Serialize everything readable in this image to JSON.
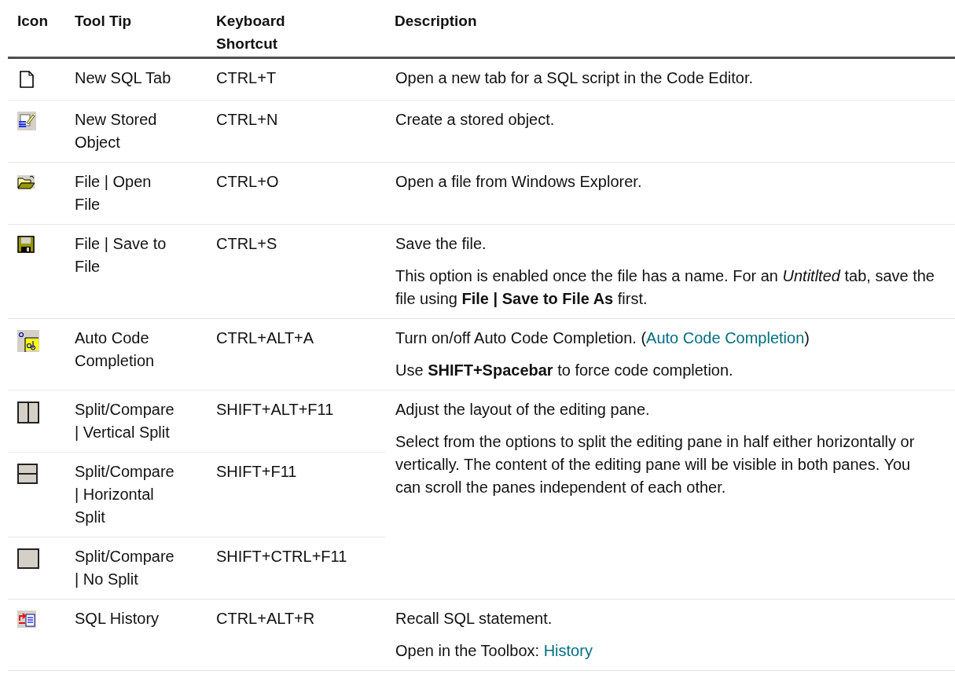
{
  "table": {
    "columns": [
      "Icon",
      "Tool Tip",
      "Keyboard Shortcut",
      "Description"
    ],
    "rows": [
      {
        "kind": "page",
        "tooltip": "New SQL Tab",
        "shortcut": "CTRL+T",
        "description": [
          [
            {
              "kind": "text",
              "text": "Open a new tab for a SQL script in the Code Editor."
            }
          ]
        ]
      },
      {
        "kind": "stored-object",
        "tooltip": "New Stored Object",
        "shortcut": "CTRL+N",
        "description": [
          [
            {
              "kind": "text",
              "text": "Create a stored object."
            }
          ]
        ]
      },
      {
        "kind": "folder",
        "tooltip": "File | Open File",
        "shortcut": "CTRL+O",
        "description": [
          [
            {
              "kind": "text",
              "text": "Open a file from Windows Explorer."
            }
          ]
        ]
      },
      {
        "kind": "floppy",
        "tooltip": "File | Save to File",
        "shortcut": "CTRL+S",
        "description": [
          [
            {
              "kind": "text",
              "text": "Save the file."
            }
          ],
          [
            {
              "kind": "text",
              "text": "This option is enabled once the file has a name. For an *Untitlted* tab, save the file using **File | Save to File As** first."
            }
          ]
        ]
      },
      {
        "kind": "autocomplete",
        "tooltip": "Auto Code Completion",
        "shortcut": "CTRL+ALT+A",
        "description": [
          [
            {
              "kind": "text",
              "text": "Turn on/off Auto Code Completion. ("
            },
            {
              "kind": "link",
              "text": "Auto Code Completion"
            },
            {
              "kind": "text",
              "text": ")"
            }
          ],
          [
            {
              "kind": "text",
              "text": "Use **SHIFT+Spacebar** to force code completion."
            }
          ]
        ]
      },
      {
        "kind": "split-vertical",
        "tooltip": "Split/Compare | Vertical Split",
        "shortcut": "SHIFT+ALT+F11",
        "description": [
          [
            {
              "kind": "text",
              "text": "Adjust the layout of the editing pane."
            }
          ],
          [
            {
              "kind": "text",
              "text": "Select from the options to split the editing pane in half either horizontally or vertically. The content of the editing pane will be visible in both panes. You can scroll the panes independent of each other."
            }
          ]
        ]
      },
      {
        "kind": "split-horizontal",
        "tooltip": "Split/Compare | Horizontal Split",
        "shortcut": "SHIFT+F11"
      },
      {
        "kind": "no-split",
        "tooltip": "Split/Compare | No Split",
        "shortcut": "SHIFT+CTRL+F11"
      },
      {
        "kind": "history",
        "tooltip": "SQL History",
        "shortcut": "CTRL+ALT+R",
        "description": [
          [
            {
              "kind": "text",
              "text": "Recall SQL statement."
            }
          ],
          [
            {
              "kind": "text",
              "text": "Open in the Toolbox: "
            },
            {
              "kind": "link",
              "text": "History"
            }
          ]
        ]
      }
    ]
  }
}
